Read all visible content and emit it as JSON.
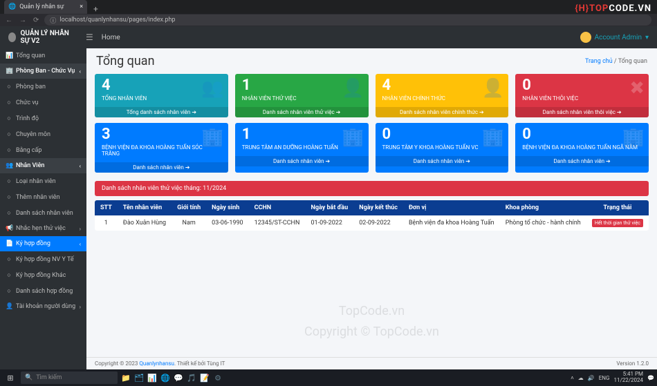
{
  "browser": {
    "tab_title": "Quản lý nhân sự",
    "url": "localhost/quanlynhansu/pages/index.php"
  },
  "logo_overlay": {
    "prefix": "{H}",
    "mid": "TOP",
    "suffix": "CODE.VN"
  },
  "header": {
    "brand": "QUẢN LÝ NHÂN SỰ V2",
    "home": "Home",
    "account": "Account Admin"
  },
  "sidebar": {
    "items": [
      {
        "ico": "📊",
        "label": "Tổng quan",
        "cls": ""
      },
      {
        "ico": "🏢",
        "label": "Phòng Ban - Chức Vụ",
        "cls": "hdr",
        "chev": "‹"
      },
      {
        "ico": "○",
        "label": "Phòng ban",
        "cls": ""
      },
      {
        "ico": "○",
        "label": "Chức vụ",
        "cls": ""
      },
      {
        "ico": "○",
        "label": "Trình độ",
        "cls": ""
      },
      {
        "ico": "○",
        "label": "Chuyên môn",
        "cls": ""
      },
      {
        "ico": "○",
        "label": "Bằng cấp",
        "cls": ""
      },
      {
        "ico": "👥",
        "label": "Nhân Viên",
        "cls": "hdr",
        "chev": "‹"
      },
      {
        "ico": "○",
        "label": "Loại nhân viên",
        "cls": ""
      },
      {
        "ico": "○",
        "label": "Thêm nhân viên",
        "cls": ""
      },
      {
        "ico": "○",
        "label": "Danh sách nhân viên",
        "cls": ""
      },
      {
        "ico": "📢",
        "label": "Nhắc hẹn thử việc",
        "cls": "",
        "chev": "›"
      },
      {
        "ico": "📄",
        "label": "Ký hợp đồng",
        "cls": "active",
        "chev": "‹"
      },
      {
        "ico": "○",
        "label": "Ký hợp đồng NV Y Tế",
        "cls": ""
      },
      {
        "ico": "○",
        "label": "Ký hợp đồng Khác",
        "cls": ""
      },
      {
        "ico": "○",
        "label": "Danh sách hợp đồng",
        "cls": ""
      },
      {
        "ico": "👤",
        "label": "Tài khoản người dùng",
        "cls": "",
        "chev": "›"
      }
    ]
  },
  "page": {
    "title": "Tổng quan",
    "crumb_home": "Trang chủ",
    "crumb_sep": " / ",
    "crumb_cur": "Tổng quan"
  },
  "row1": [
    {
      "num": "4",
      "label": "TỔNG NHÂN VIÊN",
      "foot": "Tổng danh sách nhân viên ➔",
      "cls": "c-teal",
      "ico": "👥"
    },
    {
      "num": "1",
      "label": "NHÂN VIÊN THỬ VIỆC",
      "foot": "Danh sách nhân viên thử việc ➔",
      "cls": "c-green",
      "ico": "👤"
    },
    {
      "num": "4",
      "label": "NHÂN VIÊN CHÍNH THỨC",
      "foot": "Danh sách nhân viên chính thức ➔",
      "cls": "c-yellow",
      "ico": "👤"
    },
    {
      "num": "0",
      "label": "NHÂN VIÊN THÔI VIỆC",
      "foot": "Danh sách nhân viên thôi việc ➔",
      "cls": "c-red",
      "ico": "✖"
    }
  ],
  "row2": [
    {
      "num": "3",
      "label": "BỆNH VIỆN ĐA KHOA HOÀNG TUẤN SÓC TRĂNG",
      "foot": "Danh sách nhân viên ➔",
      "cls": "c-blue",
      "ico": "🏢"
    },
    {
      "num": "1",
      "label": "TRUNG TÂM AN DƯỠNG HOÀNG TUẤN",
      "foot": "Danh sách nhân viên ➔",
      "cls": "c-blue",
      "ico": "🏢"
    },
    {
      "num": "0",
      "label": "TRUNG TÂM Y KHOA HOÀNG TUẤN VC",
      "foot": "Danh sách nhân viên ➔",
      "cls": "c-blue",
      "ico": "🏢"
    },
    {
      "num": "0",
      "label": "BỆNH VIỆN ĐA KHOA HOÀNG TUẤN NGÃ NĂM",
      "foot": "Danh sách nhân viên ➔",
      "cls": "c-blue",
      "ico": "🏢"
    }
  ],
  "alert": "Danh sách nhân viên thử việc tháng: 11/2024",
  "table": {
    "head": [
      "STT",
      "Tên nhân viên",
      "Giới tính",
      "Ngày sinh",
      "CCHN",
      "Ngày bắt đầu",
      "Ngày kết thúc",
      "Đơn vị",
      "Khoa phòng",
      "Trạng thái"
    ],
    "rows": [
      {
        "stt": "1",
        "ten": "Đào Xuân Hùng",
        "gt": "Nam",
        "ns": "03-06-1990",
        "cchn": "12345/ST-CCHN",
        "nbd": "01-09-2022",
        "nkt": "02-09-2022",
        "dv": "Bệnh viện đa khoa Hoàng Tuấn",
        "kp": "Phòng tổ chức - hành chính",
        "tt": "Hết thời gian thử việc"
      }
    ]
  },
  "watermarks": [
    "TopCode.vn",
    "Copyright © TopCode.vn"
  ],
  "footer": {
    "left_prefix": "Copyright © 2023 ",
    "left_link": "Quanlynhansu",
    "left_suffix": ". Thiết kế bởi Tùng IT",
    "right": "Version 1.2.0"
  },
  "taskbar": {
    "search": "Tìm kiếm",
    "time": "5:41 PM",
    "date": "11/22/2024",
    "lang": "ENG"
  }
}
